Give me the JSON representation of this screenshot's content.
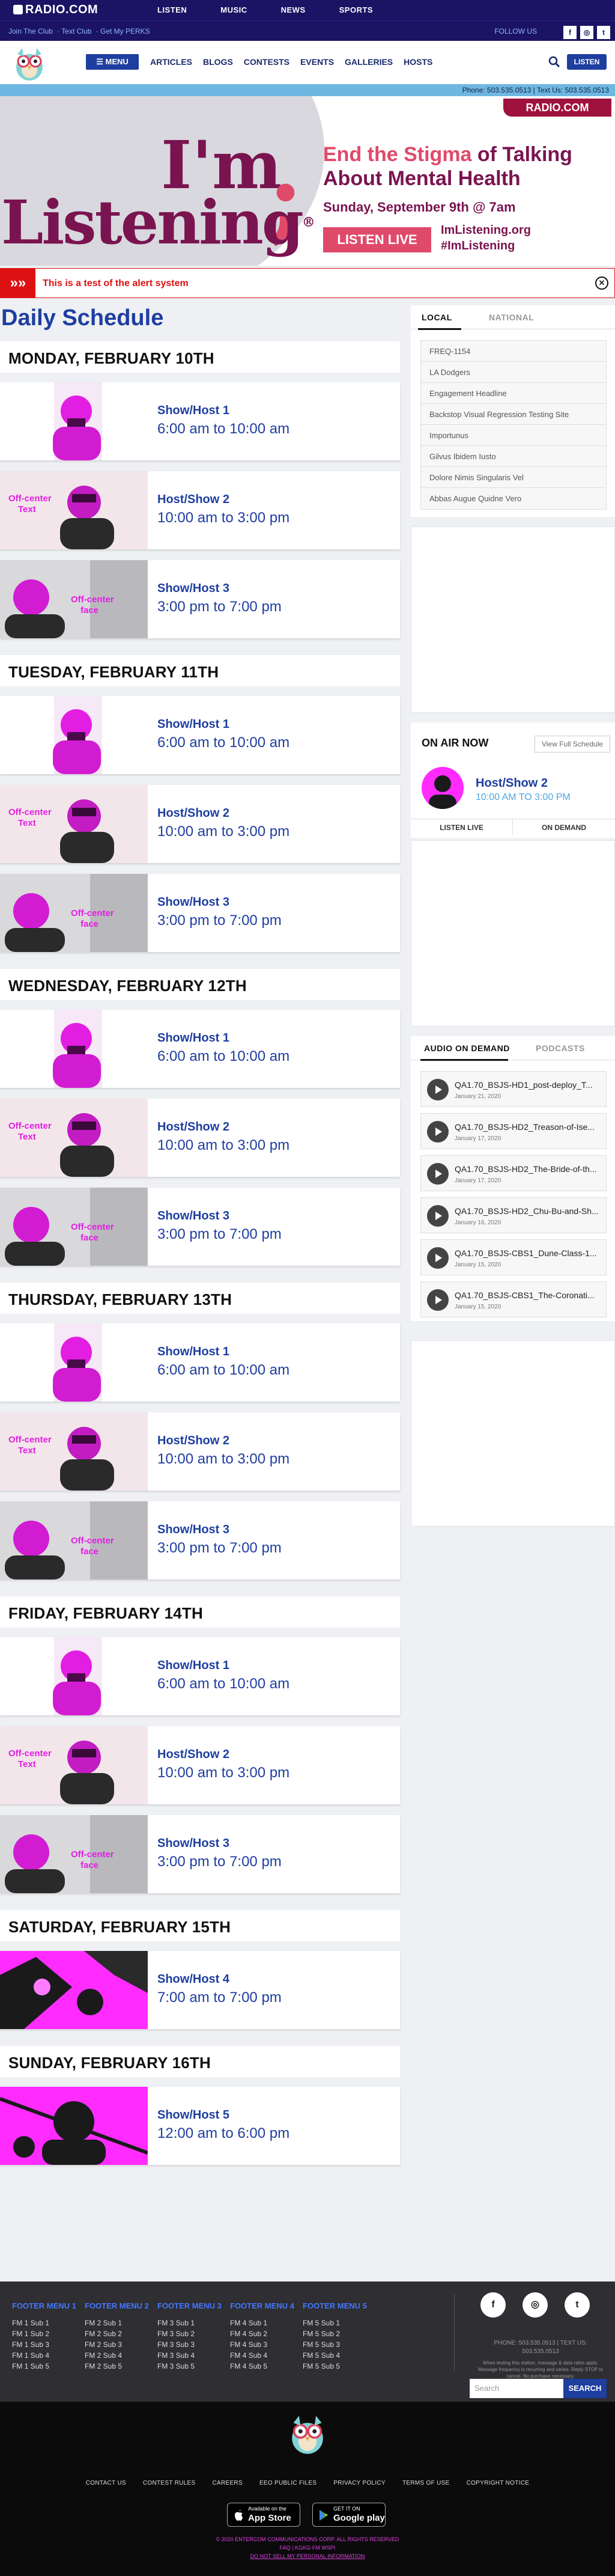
{
  "topbar": {
    "logo": "RADIO.COM",
    "nav": [
      "LISTEN",
      "MUSIC",
      "NEWS",
      "SPORTS"
    ]
  },
  "subbar": {
    "links": [
      "Join The Club",
      "Text Club",
      "Get My PERKS"
    ],
    "follow": "FOLLOW US"
  },
  "mainnav": {
    "menu_label": "MENU",
    "items": [
      "ARTICLES",
      "BLOGS",
      "CONTESTS",
      "EVENTS",
      "GALLERIES",
      "HOSTS"
    ],
    "listen_label": "LISTEN"
  },
  "phonebar": {
    "text": "Phone: 503.535.0513 | Text Us: 503.535.0513"
  },
  "banner": {
    "tag": "RADIO.COM",
    "im": "I'm",
    "listening": "Listening",
    "line1a": "End the Stigma",
    "line1b": " of Talking",
    "line2": "About Mental Health",
    "date": "Sunday, September 9th @ 7am",
    "button": "LISTEN LIVE",
    "site": "ImListening.org",
    "hashtag": "#ImListening"
  },
  "alert": {
    "text": "This is a test of the alert system"
  },
  "page_title": "Daily Schedule",
  "days": [
    {
      "label": "MONDAY, FEBRUARY 10TH",
      "shows": [
        {
          "name": "Show/Host 1",
          "time": "6:00 am to 10:00 am"
        },
        {
          "name": "Host/Show 2",
          "time": "10:00 am to 3:00 pm"
        },
        {
          "name": "Show/Host 3",
          "time": "3:00 pm to 7:00 pm"
        }
      ]
    },
    {
      "label": "TUESDAY, FEBRUARY 11TH",
      "shows": [
        {
          "name": "Show/Host 1",
          "time": "6:00 am to 10:00 am"
        },
        {
          "name": "Host/Show 2",
          "time": "10:00 am to 3:00 pm"
        },
        {
          "name": "Show/Host 3",
          "time": "3:00 pm to 7:00 pm"
        }
      ]
    },
    {
      "label": "WEDNESDAY, FEBRUARY 12TH",
      "shows": [
        {
          "name": "Show/Host 1",
          "time": "6:00 am to 10:00 am"
        },
        {
          "name": "Host/Show 2",
          "time": "10:00 am to 3:00 pm"
        },
        {
          "name": "Show/Host 3",
          "time": "3:00 pm to 7:00 pm"
        }
      ]
    },
    {
      "label": "THURSDAY, FEBRUARY 13TH",
      "shows": [
        {
          "name": "Show/Host 1",
          "time": "6:00 am to 10:00 am"
        },
        {
          "name": "Host/Show 2",
          "time": "10:00 am to 3:00 pm"
        },
        {
          "name": "Show/Host 3",
          "time": "3:00 pm to 7:00 pm"
        }
      ]
    },
    {
      "label": "FRIDAY, FEBRUARY 14TH",
      "shows": [
        {
          "name": "Show/Host 1",
          "time": "6:00 am to 10:00 am"
        },
        {
          "name": "Host/Show 2",
          "time": "10:00 am to 3:00 pm"
        },
        {
          "name": "Show/Host 3",
          "time": "3:00 pm to 7:00 pm"
        }
      ]
    },
    {
      "label": "SATURDAY, FEBRUARY 15TH",
      "shows": [
        {
          "name": "Show/Host 4",
          "time": "7:00 am to 7:00 pm"
        }
      ]
    },
    {
      "label": "SUNDAY, FEBRUARY 16TH",
      "shows": [
        {
          "name": "Show/Host 5",
          "time": "12:00 am to 6:00 pm"
        }
      ]
    }
  ],
  "thumb_text": {
    "off_center_text": "Off-center Text",
    "off_center_face": "Off-center face"
  },
  "news": {
    "tabs": [
      "LOCAL",
      "NATIONAL"
    ],
    "items": [
      "FREQ-1154",
      "LA Dodgers",
      "Engagement Headline",
      "Backstop Visual Regression Testing Site",
      "Importunus",
      "Gilvus Ibidem Iusto",
      "Dolore Nimis Singularis Vel",
      "Abbas Augue Quidne Vero"
    ]
  },
  "onair": {
    "label": "ON AIR NOW",
    "schedule_link": "View Full Schedule",
    "host": "Host/Show 2",
    "time": "10:00 AM TO 3:00 PM",
    "listen_live": "LISTEN LIVE",
    "on_demand": "ON DEMAND"
  },
  "aod": {
    "tabs": [
      "AUDIO ON DEMAND",
      "PODCASTS"
    ],
    "items": [
      {
        "title": "QA1.70_BSJS-HD1_post-deploy_T...",
        "date": "January 21, 2020"
      },
      {
        "title": "QA1.70_BSJS-HD2_Treason-of-Ise...",
        "date": "January 17, 2020"
      },
      {
        "title": "QA1.70_BSJS-HD2_The-Bride-of-th...",
        "date": "January 17, 2020"
      },
      {
        "title": "QA1.70_BSJS-HD2_Chu-Bu-and-Sh...",
        "date": "January 16, 2020"
      },
      {
        "title": "QA1.70_BSJS-CBS1_Dune-Class-1...",
        "date": "January 15, 2020"
      },
      {
        "title": "QA1.70_BSJS-CBS1_The-Coronati...",
        "date": "January 15, 2020"
      }
    ]
  },
  "footer": {
    "menus": [
      {
        "title": "FOOTER MENU 1",
        "items": [
          "FM 1 Sub 1",
          "FM 1 Sub 2",
          "FM 1 Sub 3",
          "FM 1 Sub 4",
          "FM 1 Sub 5"
        ]
      },
      {
        "title": "FOOTER MENU 2",
        "items": [
          "FM 2 Sub 1",
          "FM 2 Sub 2",
          "FM 2 Sub 3",
          "FM 2 Sub 4",
          "FM 2 Sub 5"
        ]
      },
      {
        "title": "FOOTER MENU 3",
        "items": [
          "FM 3 Sub 1",
          "FM 3 Sub 2",
          "FM 3 Sub 3",
          "FM 3 Sub 4",
          "FM 3 Sub 5"
        ]
      },
      {
        "title": "FOOTER MENU 4",
        "items": [
          "FM 4 Sub 1",
          "FM 4 Sub 2",
          "FM 4 Sub 3",
          "FM 4 Sub 4",
          "FM 4 Sub 5"
        ]
      },
      {
        "title": "FOOTER MENU 5",
        "items": [
          "FM 5 Sub 1",
          "FM 5 Sub 2",
          "FM 5 Sub 3",
          "FM 5 Sub 4",
          "FM 5 Sub 5"
        ]
      }
    ],
    "contact_line1": "PHONE: 503.535.0513 | TEXT US:",
    "contact_line2": "503.535.0513",
    "contact_line3": "When texting this station, message & data rates apply. Message frequency is recurring and varies. Reply STOP to cancel. No purchase necessary.",
    "search_placeholder": "Search",
    "search_button": "SEARCH",
    "links": [
      "CONTACT US",
      "CONTEST RULES",
      "CAREERS",
      "EEO PUBLIC FILES",
      "PRIVACY POLICY",
      "TERMS OF USE",
      "COPYRIGHT NOTICE"
    ],
    "app_store_small": "Available on the",
    "app_store": "App Store",
    "google_small": "GET IT ON",
    "google": "Google play",
    "eeo1": "© 2020 ENTERCOM COMMUNICATIONS CORP. ALL RIGHTS RESERVED",
    "eeo2": "FAQ | KGKG-FM WSPI",
    "eeo3": "DO NOT SELL MY PERSONAL INFORMATION"
  }
}
